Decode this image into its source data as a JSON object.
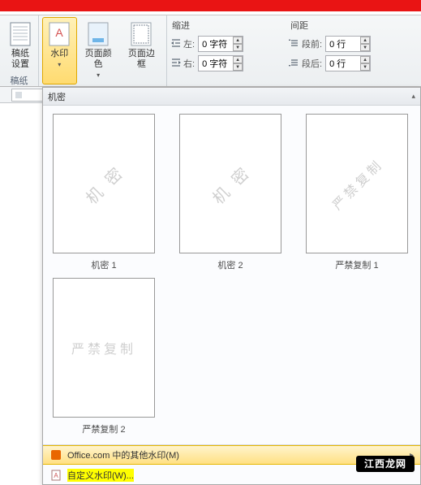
{
  "ribbon": {
    "group_draft": {
      "btn": "稿纸\n设置",
      "label": "稿纸"
    },
    "group_bg": {
      "watermark": "水印",
      "pagecolor": "页面颜色",
      "pageborder": "页面边框"
    },
    "indent": {
      "title": "缩进",
      "left_label": "左:",
      "left_value": "0 字符",
      "right_label": "右:",
      "right_value": "0 字符"
    },
    "spacing": {
      "title": "间距",
      "before_label": "段前:",
      "before_value": "0 行",
      "after_label": "段后:",
      "after_value": "0 行"
    }
  },
  "gallery": {
    "title": "机密",
    "items": [
      {
        "wm": "机 密",
        "caption": "机密 1"
      },
      {
        "wm": "机 密",
        "caption": "机密 2"
      },
      {
        "wm": "严禁复制",
        "caption": "严禁复制 1"
      },
      {
        "wm": "严禁复制",
        "caption": "严禁复制 2"
      }
    ],
    "more": "Office.com 中的其他水印(M)",
    "custom": "自定义水印(W)..."
  },
  "brand": "江西龙网"
}
